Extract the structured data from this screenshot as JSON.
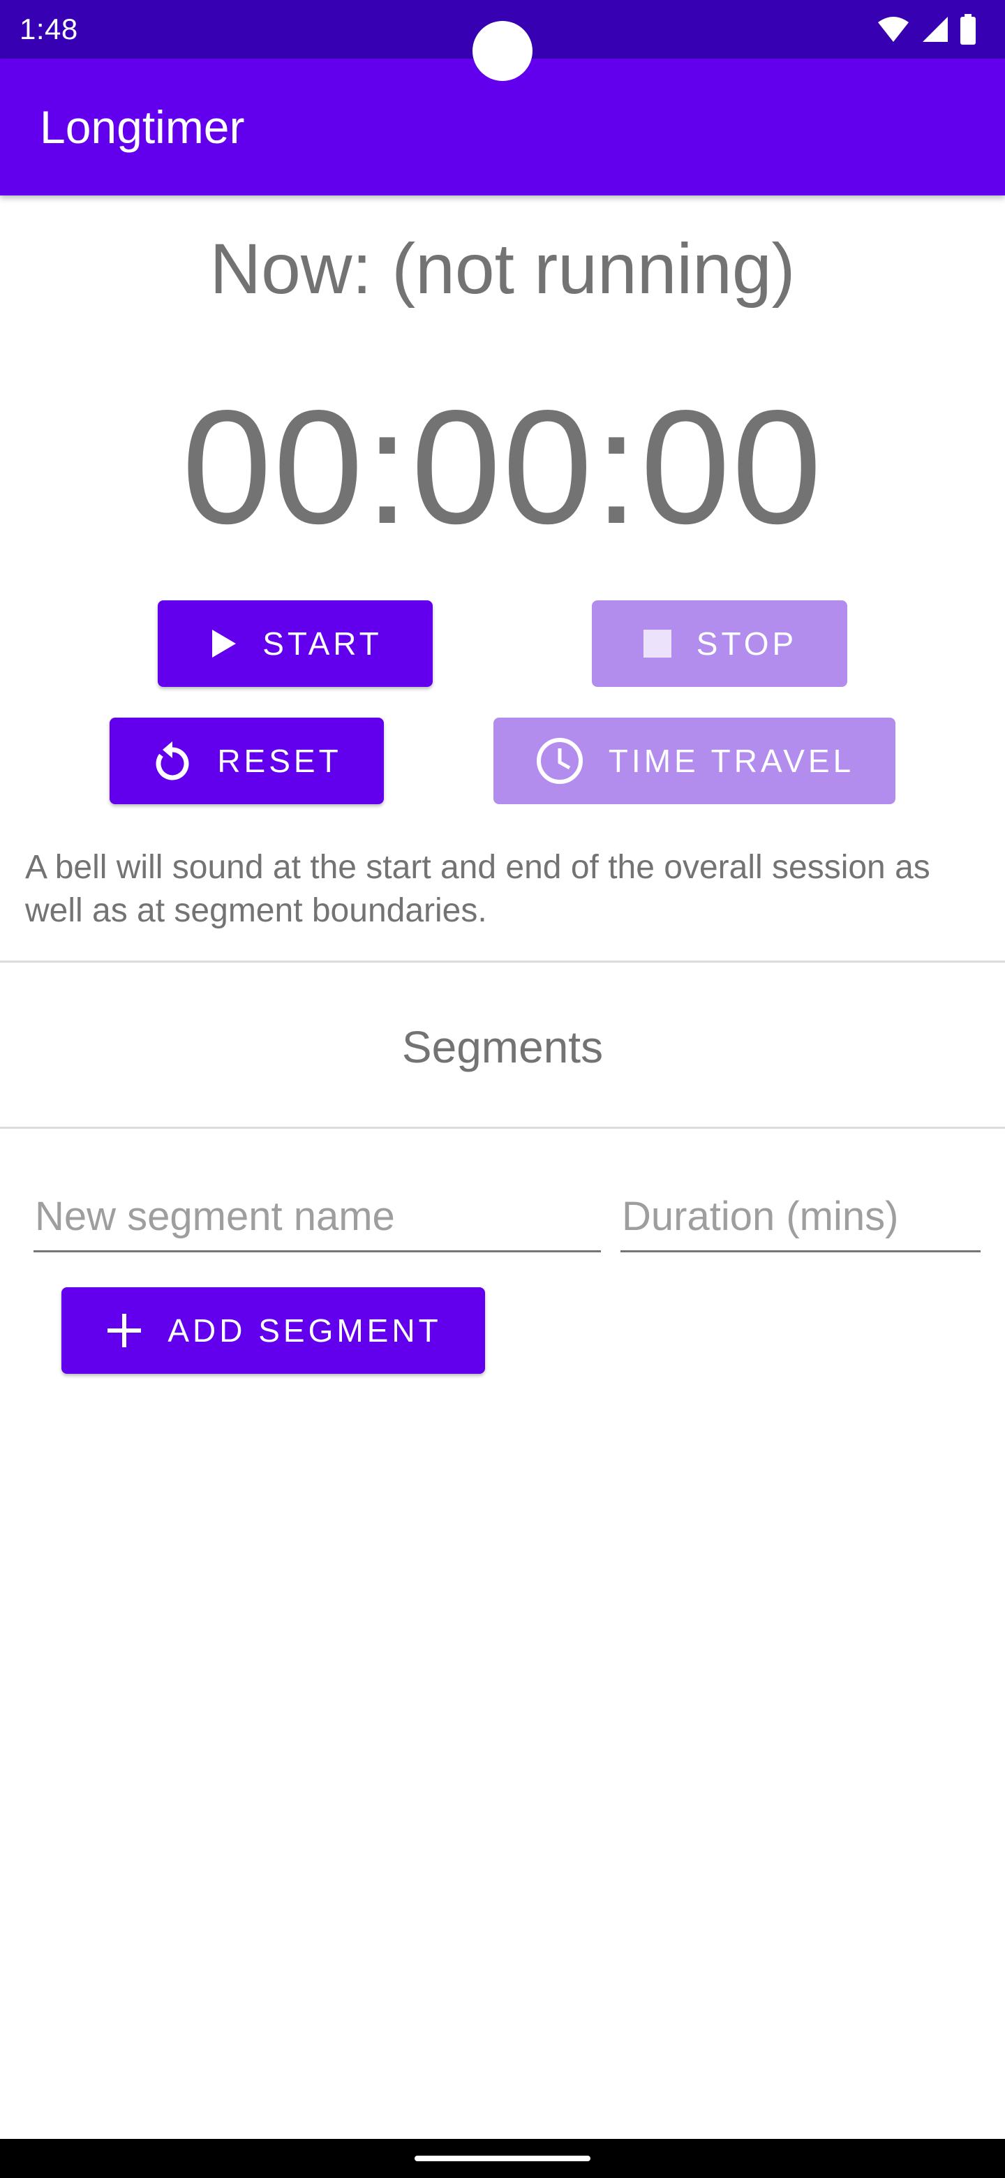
{
  "status_bar": {
    "time": "1:48",
    "background": "#3700b3",
    "icons": [
      "wifi-icon",
      "signal-icon",
      "battery-icon"
    ]
  },
  "app_bar": {
    "title": "Longtimer",
    "background": "#6200ee"
  },
  "timer": {
    "now_label": "Now: (not running)",
    "display": "00:00:00"
  },
  "controls": {
    "start_label": "START",
    "stop_label": "STOP",
    "reset_label": "RESET",
    "time_travel_label": "TIME TRAVEL",
    "start_icon": "play-icon",
    "stop_icon": "stop-icon",
    "reset_icon": "reset-icon",
    "time_travel_icon": "clock-icon",
    "primary_color": "#6200ee",
    "disabled_color": "#b38ded"
  },
  "info": {
    "text": "A bell will sound at the start and end of the overall session as well as at segment boundaries."
  },
  "segments": {
    "heading": "Segments",
    "name_placeholder": "New segment name",
    "name_value": "",
    "duration_placeholder": "Duration (mins)",
    "duration_value": "",
    "add_label": "ADD SEGMENT",
    "add_icon": "plus-icon"
  }
}
